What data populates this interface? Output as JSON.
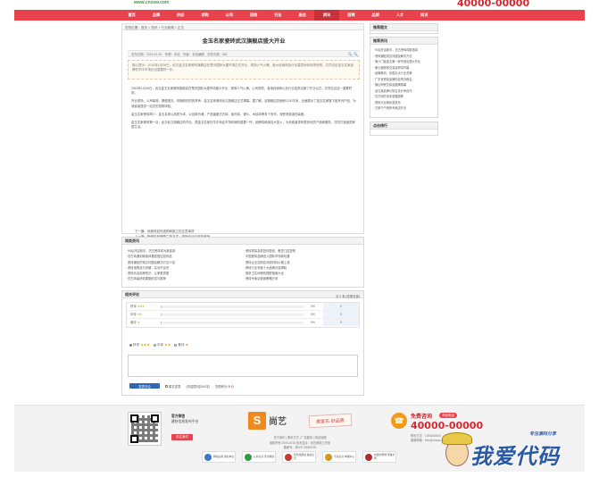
{
  "header": {
    "logo_text": "www.cnzsw.com",
    "hotline": "40000-00000"
  },
  "nav": {
    "items": [
      "首页",
      "品牌",
      "供应",
      "求购",
      "公司",
      "招商",
      "行业",
      "展会",
      "资讯",
      "招聘",
      "品牌",
      "人才",
      "知识"
    ],
    "active_index": 8
  },
  "breadcrumb": "您的位置：首页 > 资讯 > 行业新闻 > 正文",
  "article": {
    "title": "金玉名家瓷砖武汉旗舰店盛大开业",
    "meta": "发布日期：2015-01-30　来源：本站　作者：本站编辑　浏览次数：881",
    "tools": "🔍 🔍",
    "summary": "核心提示：2015年1月26日，武汉金玉名家瓷砖旗舰店在楚天国际大建市场正式开业，现场人气火爆，各大经销商及行业嘉宾纷纷到场祝贺，共同见证金玉名家品牌在华中市场迈出重要的一步。",
    "paragraphs": [
      "2015年1月26日，武汉金玉名家瓷砖旗舰店在楚天国际大建市场盛大开业，现场人气火爆。公司领导、各地经销商以及行业嘉宾出席了开业仪式，共同见证这一重要时刻。",
      "开业现场，人声鼎沸，锣鼓喧天。伴随着热烈的掌声，金玉名家瓷砖武汉旗舰店正式揭幕。据了解，该旗舰店总面积1200平米，全面展示了金玉名家旗下各系列产品，为消费者提供一站式的选购体验。",
      "金玉名家瓷砖简介：金玉名家以品质为本，以创新为魂，产品涵盖仿古砖、抛光砖、瓷片、木纹砖等多个系列，深受消费者的喜爱。",
      "金玉名家瓷砖第一店：此次武汉旗舰店的开业，是金玉名家在华中地区市场布局的重要一环。品牌将继续加大投入，为消费者带来更多优质产品和服务，共同打造品质家居生活。"
    ],
    "prev": "下一篇：纯瓷砖如何选购和施工的注意事项",
    "next": "上一篇：陶瓷砖品牌推广新方式：促销活动与体验营销",
    "actions": "[ 资讯搜索 ]　[ 加入收藏 ]　[ 告诉好友 ]　[ 打印本文 ]　[ 关闭窗口 ]"
  },
  "related": {
    "title": "同类资讯",
    "items": [
      "· 90后开店新手，仿古瓷砖成为新选择",
      "· 瓷砖质量高低如何检验，教您几招鉴别",
      "· 仿古砖遇到家装风格混搭应如何选",
      "· 中国瓷砖品牌进入国际市场新机遇",
      "· 瓷砖铺贴的常见问题及解决方法介绍",
      "· 瓷砖企业如何应对原材料价格上涨",
      "· 瓷砖选购技巧详解，买对不买贵",
      "· 瓷砖行业年度十大品牌评选揭晓",
      "· 瓷砖清洁保养知识，让家更亮丽",
      "· 厨房卫生间瓷砖搭配指南大全",
      "· 仿古砖装修效果图欣赏与推荐",
      "· 瓷砖专卖店营销策略分享"
    ]
  },
  "comments": {
    "title": "相关评论",
    "right_info": "共 0 条 [查看全部]",
    "ratings": [
      {
        "label": "好评",
        "stars": "★★★",
        "pct": "0%",
        "count": "0"
      },
      {
        "label": "中评",
        "stars": "★★",
        "pct": "0%",
        "count": "0"
      },
      {
        "label": "差评",
        "stars": "★",
        "pct": "0%",
        "count": "0"
      }
    ],
    "radio_good": "好评",
    "radio_mid": "中评",
    "radio_bad": "差评",
    "radio_stars_good": "★★★",
    "radio_stars_mid": "★★",
    "radio_stars_bad": "★",
    "submit_label": "发表评论",
    "anonymous_label": "匿名发表",
    "length_hint": "(内容限5至500字)",
    "login_hint_prefix": "您的积分",
    "login_hint_value": "0",
    "login_hint_suffix": "分"
  },
  "sidebar": {
    "recommend_title": "推荐图文",
    "news_title": "推荐资讯",
    "news_items": [
      "· 90后开店新手，仿古瓷砖成新选择",
      "· 瓷砖铺贴常见问题及解决方法",
      "· 第六门窗金玉第一家专营店盛大开业",
      "· 第七届瓷砖交易会即将开幕",
      "· 品牌推动，优胜劣汰行业洗牌",
      "· 广东省瓷砖品牌协会举办峰会",
      "· 佛山陶瓷交易会圆满落幕",
      "· 武汉某品牌与知名设计师合作",
      "· 仿古砖的未来发展趋势",
      "· 瓷砖行业新标准发布",
      "· 万家千户瓷砖专卖店开业"
    ],
    "hits_title": "点击排行"
  },
  "footer": {
    "wechat_title": "官方微信",
    "wechat_desc": "建材信息发布平台",
    "wechat_button": "关注我们",
    "brand_name": "尚艺",
    "brand_slogan": "居家乐·好品质",
    "links": "关于我们 | 联系方式 | 广告服务 | 网站地图\n版权所有 2000-2015 技术支持：尚艺网络工作室\n备案号：粤ICP-20080159",
    "tel_label": "免费咨询",
    "tel_pill": "热线电话",
    "tel_number": "40000-00000",
    "tel_meta": "联系方式：1391800000\n客服邮箱：info@cnzsw.com",
    "badges": [
      "网站信用 诚信单位",
      "公共信息 安全网络",
      "经营性网站 备案信息",
      "不良信息 举报中心",
      "中国文明网 传播文明"
    ],
    "badge_colors": [
      "#3b79c4",
      "#2f9b46",
      "#c63a2f",
      "#d19a1f",
      "#b22b2b"
    ]
  },
  "watermark": {
    "text": "我爱代码",
    "sub": "专注源码分享"
  }
}
